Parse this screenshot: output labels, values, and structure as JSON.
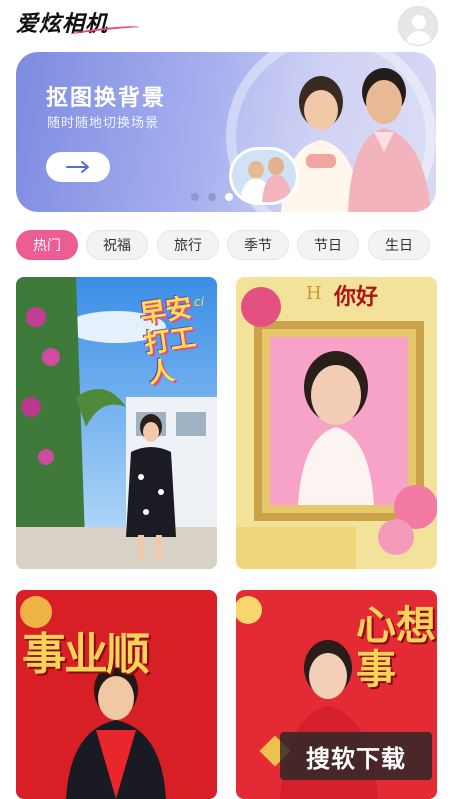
{
  "header": {
    "app_title": "爱炫相机",
    "avatar_icon": "user-avatar-icon"
  },
  "banner": {
    "title": "抠图换背景",
    "subtitle": "随时随地切换场景",
    "button_icon": "arrow-right-icon",
    "carousel": {
      "total": 3,
      "active_index": 2
    }
  },
  "tabs": [
    {
      "label": "热门",
      "active": true
    },
    {
      "label": "祝福",
      "active": false
    },
    {
      "label": "旅行",
      "active": false
    },
    {
      "label": "季节",
      "active": false
    },
    {
      "label": "节日",
      "active": false
    },
    {
      "label": "生日",
      "active": false
    }
  ],
  "templates": [
    {
      "id": "card-1",
      "overlay_text": "早安打工人",
      "overlay_suffix": "ci"
    },
    {
      "id": "card-2",
      "overlay_text": "你好",
      "overlay_frame_text": "H"
    },
    {
      "id": "card-3",
      "overlay_text": "事业顺"
    },
    {
      "id": "card-4",
      "overlay_text": "心想事"
    }
  ],
  "watermark": {
    "text": "搜软下载"
  },
  "colors": {
    "accent_pink": "#ec5d93",
    "banner_start": "#7d8be0",
    "banner_end": "#d8daf4"
  }
}
